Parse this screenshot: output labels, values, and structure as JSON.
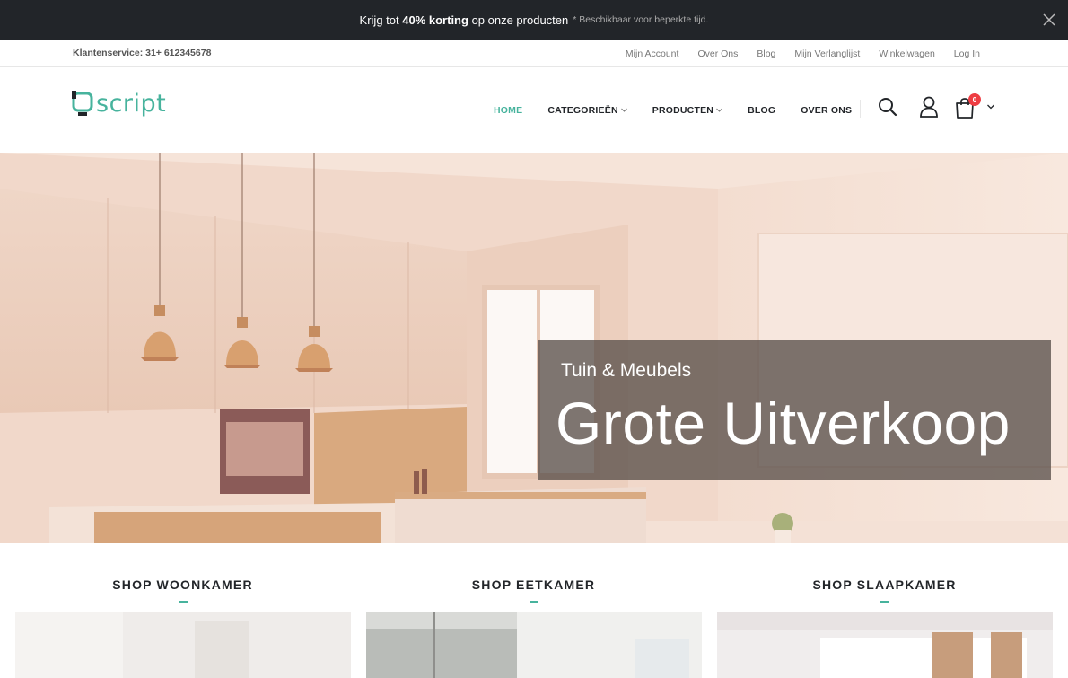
{
  "promo": {
    "prefix": "Krijg tot",
    "discount": "40% korting",
    "suffix": "op onze producten",
    "note": "* Beschikbaar voor beperkte tijd."
  },
  "topbar": {
    "service": "Klantenservice: 31+ 612345678",
    "links": [
      "Mijn Account",
      "Over Ons",
      "Blog",
      "Mijn Verlanglijst",
      "Winkelwagen",
      "Log In"
    ]
  },
  "logo": {
    "text": "script"
  },
  "nav": {
    "home": "HOME",
    "categories": "CATEGORIEËN",
    "products": "PRODUCTEN",
    "blog": "BLOG",
    "about": "OVER ONS"
  },
  "cart": {
    "count": "0"
  },
  "hero": {
    "subtitle": "Tuin & Meubels",
    "title": "Grote Uitverkoop"
  },
  "shops": [
    {
      "title": "SHOP WOONKAMER"
    },
    {
      "title": "SHOP EETKAMER"
    },
    {
      "title": "SHOP SLAAPKAMER"
    }
  ],
  "colors": {
    "accent": "#47b39d",
    "dark": "#222529",
    "badge": "#ee3d43"
  },
  "icons": [
    "close-icon",
    "search-icon",
    "user-icon",
    "cart-icon",
    "chevron-down-icon"
  ]
}
